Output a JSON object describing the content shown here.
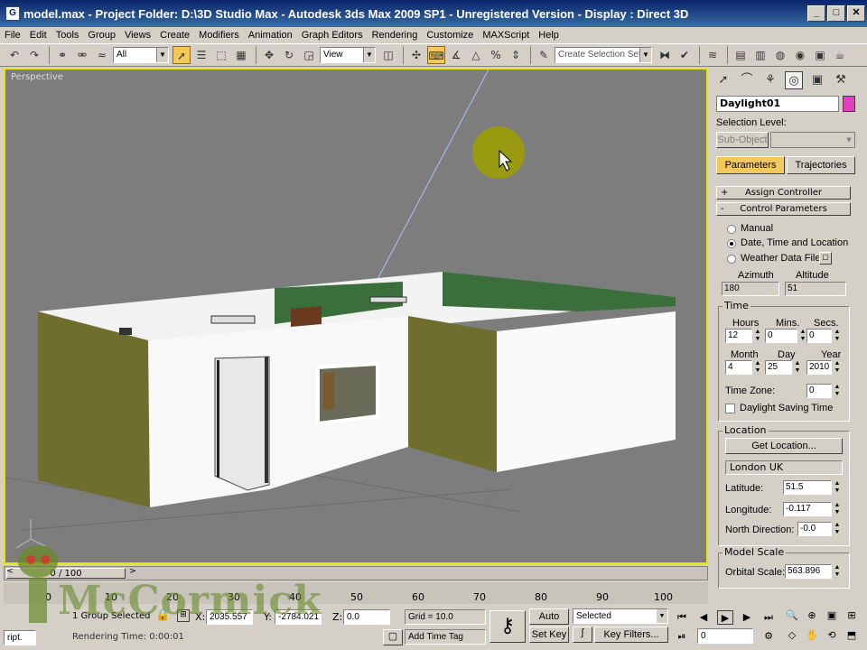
{
  "window": {
    "title": "model.max    - Project Folder: D:\\3D Studio Max    - Autodesk 3ds Max  2009 SP1    - Unregistered Version    - Display : Direct 3D"
  },
  "menu": [
    "File",
    "Edit",
    "Tools",
    "Group",
    "Views",
    "Create",
    "Modifiers",
    "Animation",
    "Graph Editors",
    "Rendering",
    "Customize",
    "MAXScript",
    "Help"
  ],
  "toolbar": {
    "filter_value": "All",
    "refcoord_value": "View",
    "selection_set_placeholder": "Create Selection Set"
  },
  "viewport": {
    "label": "Perspective",
    "border_color": "#e8e800",
    "bg_color": "#7d7d7d"
  },
  "timeline": {
    "slider_label": "0 / 100",
    "ticks": [
      "0",
      "10",
      "20",
      "30",
      "40",
      "50",
      "60",
      "70",
      "80",
      "90",
      "100"
    ]
  },
  "status": {
    "selection_text": "1 Group Selected",
    "rendering_time": "Rendering Time: 0:00:01",
    "maxscript_label": "ript.",
    "x_label": "X:",
    "x_value": "2035.557",
    "y_label": "Y:",
    "y_value": "-2784.021",
    "z_label": "Z:",
    "z_value": "0.0",
    "grid_text": "Grid = 10.0",
    "add_time_tag": "Add Time Tag",
    "auto_key": "Auto Key",
    "set_key": "Set Key",
    "key_mode_value": "Selected",
    "key_filters": "Key Filters...",
    "frame_value": "0"
  },
  "command_panel": {
    "object_name": "Daylight01",
    "object_color": "#e040c0",
    "selection_level_label": "Selection Level:",
    "sub_object_label": "Sub-Object",
    "tab_parameters": "Parameters",
    "tab_trajectories": "Trajectories",
    "rollout_assign": "Assign Controller",
    "rollout_assign_sign": "+",
    "rollout_control": "Control Parameters",
    "rollout_control_sign": "-",
    "radio_manual": "Manual",
    "radio_date": "Date, Time and Location",
    "radio_weather": "Weather Data File",
    "azimuth_label": "Azimuth",
    "altitude_label": "Altitude",
    "azimuth_value": "180",
    "altitude_value": "51",
    "time_group": "Time",
    "hours_label": "Hours",
    "mins_label": "Mins.",
    "secs_label": "Secs.",
    "hours_value": "12",
    "mins_value": "0",
    "secs_value": "0",
    "month_label": "Month",
    "day_label": "Day",
    "year_label": "Year",
    "month_value": "4",
    "day_value": "25",
    "year_value": "2010",
    "timezone_label": "Time Zone:",
    "timezone_value": "0",
    "daylight_saving": "Daylight Saving Time",
    "location_group": "Location",
    "get_location": "Get Location...",
    "location_value": "London UK",
    "latitude_label": "Latitude:",
    "latitude_value": "51.5",
    "longitude_label": "Longitude:",
    "longitude_value": "-0.117",
    "north_label": "North Direction:",
    "north_value": "-0.0",
    "model_scale_group": "Model Scale",
    "orbital_label": "Orbital Scale:",
    "orbital_value": "563.896"
  },
  "watermark": "McCormick"
}
